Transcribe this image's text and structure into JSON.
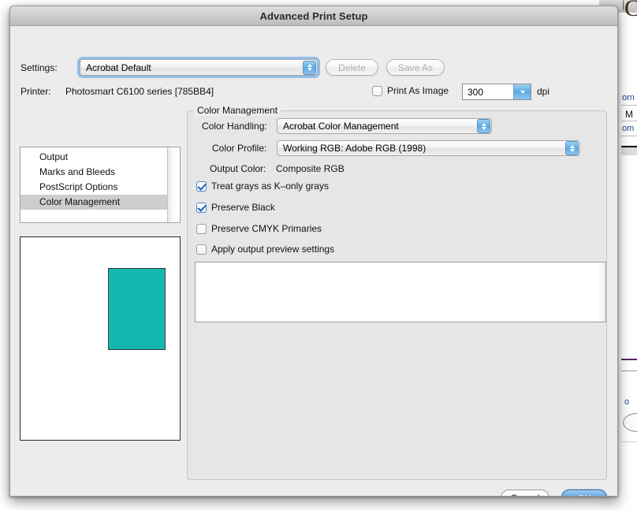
{
  "window": {
    "title": "Advanced Print Setup"
  },
  "settings_row": {
    "label": "Settings:",
    "selected": "Acrobat Default",
    "delete_button": "Delete",
    "save_as_button": "Save As"
  },
  "printer_row": {
    "label": "Printer:",
    "value": "Photosmart C6100 series [785BB4]",
    "print_as_image_label": "Print As Image",
    "print_as_image_checked": false,
    "dpi_value": "300",
    "dpi_unit": "dpi"
  },
  "sidebar": {
    "items": [
      {
        "label": "Output",
        "selected": false
      },
      {
        "label": "Marks and Bleeds",
        "selected": false
      },
      {
        "label": "PostScript Options",
        "selected": false
      },
      {
        "label": "Color Management",
        "selected": true
      }
    ]
  },
  "preview": {
    "page_color": "#ffffff",
    "art_color": "#12b8ae"
  },
  "group": {
    "title": "Color Management",
    "color_handling_label": "Color Handling:",
    "color_handling_value": "Acrobat Color Management",
    "color_profile_label": "Color Profile:",
    "color_profile_value": "Working RGB: Adobe RGB (1998)",
    "output_color_label": "Output Color:",
    "output_color_value": "Composite RGB",
    "checkboxes": [
      {
        "label": "Treat grays as K–only grays",
        "checked": true
      },
      {
        "label": "Preserve Black",
        "checked": true
      },
      {
        "label": "Preserve CMYK Primaries",
        "checked": false
      },
      {
        "label": "Apply output preview settings",
        "checked": false
      }
    ],
    "description_text": ""
  },
  "footer": {
    "cancel_button": "Cancel",
    "ok_button": "OK"
  },
  "background_window": {
    "fragments": [
      "orn",
      "M",
      "om",
      "o"
    ]
  },
  "colors": {
    "accent_blue": "#3d8ed6",
    "teal_art": "#12b8ae",
    "dialog_bg": "#ececec",
    "group_bg": "#e6e6e6",
    "selection_gray": "#cdcdcd"
  }
}
